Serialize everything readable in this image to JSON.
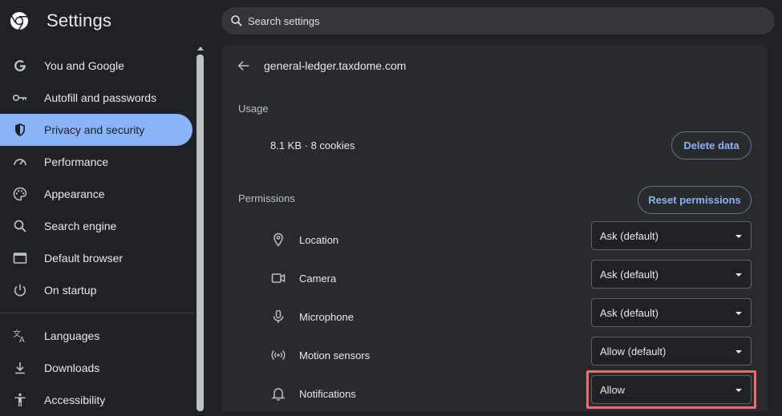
{
  "header": {
    "title": "Settings",
    "logo_icon": "chrome-logo-icon",
    "search": {
      "placeholder": "Search settings",
      "icon": "search-icon"
    }
  },
  "sidebar": {
    "items": [
      {
        "label": "You and Google",
        "icon": "google-g-icon",
        "active": false
      },
      {
        "label": "Autofill and passwords",
        "icon": "key-icon",
        "active": false
      },
      {
        "label": "Privacy and security",
        "icon": "shield-icon",
        "active": true
      },
      {
        "label": "Performance",
        "icon": "speedometer-icon",
        "active": false
      },
      {
        "label": "Appearance",
        "icon": "palette-icon",
        "active": false
      },
      {
        "label": "Search engine",
        "icon": "search-icon",
        "active": false
      },
      {
        "label": "Default browser",
        "icon": "browser-window-icon",
        "active": false
      },
      {
        "label": "On startup",
        "icon": "power-icon",
        "active": false
      },
      {
        "label": "Languages",
        "icon": "translate-icon",
        "active": false
      },
      {
        "label": "Downloads",
        "icon": "download-icon",
        "active": false
      },
      {
        "label": "Accessibility",
        "icon": "accessibility-icon",
        "active": false
      }
    ]
  },
  "main": {
    "site": "general-ledger.taxdome.com",
    "usage": {
      "heading": "Usage",
      "summary": "8.1 KB · 8 cookies",
      "delete_label": "Delete data"
    },
    "permissions": {
      "heading": "Permissions",
      "reset_label": "Reset permissions",
      "rows": [
        {
          "label": "Location",
          "icon": "location-pin-icon",
          "value": "Ask (default)"
        },
        {
          "label": "Camera",
          "icon": "camera-icon",
          "value": "Ask (default)"
        },
        {
          "label": "Microphone",
          "icon": "microphone-icon",
          "value": "Ask (default)"
        },
        {
          "label": "Motion sensors",
          "icon": "motion-sensor-icon",
          "value": "Allow (default)"
        },
        {
          "label": "Notifications",
          "icon": "bell-icon",
          "value": "Allow"
        }
      ]
    }
  },
  "colors": {
    "accent": "#8ab4f8",
    "background": "#202124",
    "card": "#292a2d",
    "highlight": "#f06a6a"
  }
}
